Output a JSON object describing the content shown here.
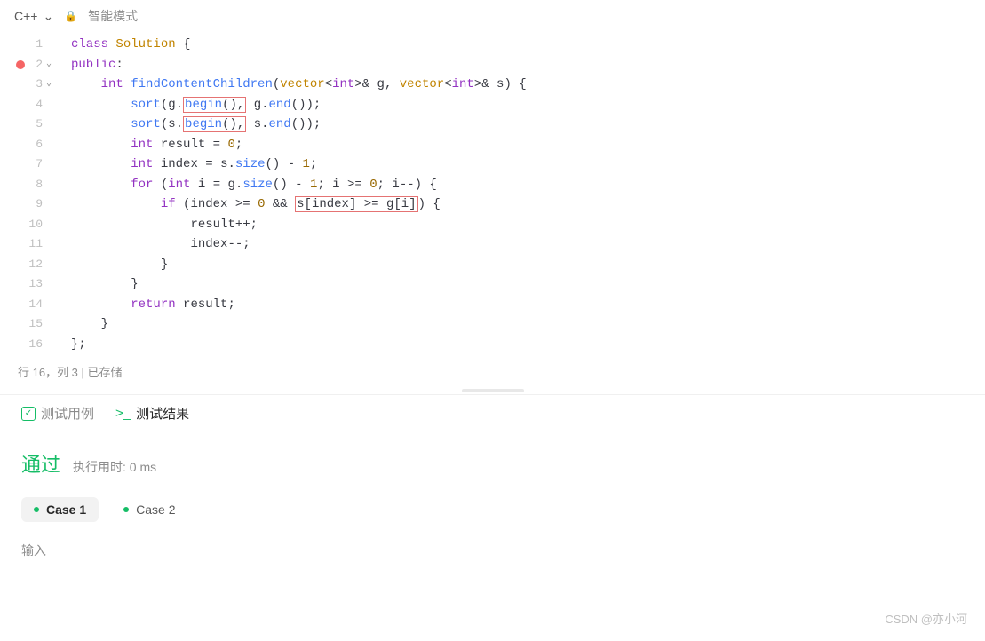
{
  "toolbar": {
    "language": "C++",
    "mode_label": "智能模式"
  },
  "code": {
    "lines": [
      {
        "n": 1,
        "tokens": [
          [
            "kw",
            "class"
          ],
          [
            "sp",
            " "
          ],
          [
            "cls",
            "Solution"
          ],
          [
            "sp",
            " "
          ],
          [
            "punct",
            "{"
          ]
        ]
      },
      {
        "n": 2,
        "breakpoint": true,
        "fold": true,
        "tokens": [
          [
            "kw",
            "public"
          ],
          [
            "punct",
            ":"
          ]
        ]
      },
      {
        "n": 3,
        "fold": true,
        "indent": 1,
        "tokens": [
          [
            "kw",
            "int"
          ],
          [
            "sp",
            " "
          ],
          [
            "fn",
            "findContentChildren"
          ],
          [
            "punct",
            "("
          ],
          [
            "type",
            "vector"
          ],
          [
            "punct",
            "<"
          ],
          [
            "kw",
            "int"
          ],
          [
            "punct",
            ">& "
          ],
          [
            "ident",
            "g"
          ],
          [
            "punct",
            ", "
          ],
          [
            "type",
            "vector"
          ],
          [
            "punct",
            "<"
          ],
          [
            "kw",
            "int"
          ],
          [
            "punct",
            ">& "
          ],
          [
            "ident",
            "s"
          ],
          [
            "punct",
            ") {"
          ]
        ]
      },
      {
        "n": 4,
        "indent": 2,
        "tokens": [
          [
            "fn",
            "sort"
          ],
          [
            "punct",
            "("
          ],
          [
            "ident",
            "g"
          ],
          [
            "punct",
            "."
          ],
          [
            "box_start",
            ""
          ],
          [
            "fn",
            "begin"
          ],
          [
            "punct",
            "(),"
          ],
          [
            "box_end",
            ""
          ],
          [
            "sp",
            " "
          ],
          [
            "ident",
            "g"
          ],
          [
            "punct",
            "."
          ],
          [
            "fn",
            "end"
          ],
          [
            "punct",
            "());"
          ]
        ]
      },
      {
        "n": 5,
        "indent": 2,
        "tokens": [
          [
            "fn",
            "sort"
          ],
          [
            "punct",
            "("
          ],
          [
            "ident",
            "s"
          ],
          [
            "punct",
            "."
          ],
          [
            "box_start",
            ""
          ],
          [
            "fn",
            "begin"
          ],
          [
            "punct",
            "(),"
          ],
          [
            "box_end",
            ""
          ],
          [
            "sp",
            " "
          ],
          [
            "ident",
            "s"
          ],
          [
            "punct",
            "."
          ],
          [
            "fn",
            "end"
          ],
          [
            "punct",
            "());"
          ]
        ]
      },
      {
        "n": 6,
        "indent": 2,
        "tokens": [
          [
            "kw",
            "int"
          ],
          [
            "sp",
            " "
          ],
          [
            "ident",
            "result"
          ],
          [
            "sp",
            " "
          ],
          [
            "punct",
            "= "
          ],
          [
            "num",
            "0"
          ],
          [
            "punct",
            ";"
          ]
        ]
      },
      {
        "n": 7,
        "indent": 2,
        "tokens": [
          [
            "kw",
            "int"
          ],
          [
            "sp",
            " "
          ],
          [
            "ident",
            "index"
          ],
          [
            "sp",
            " "
          ],
          [
            "punct",
            "= "
          ],
          [
            "ident",
            "s"
          ],
          [
            "punct",
            "."
          ],
          [
            "fn",
            "size"
          ],
          [
            "punct",
            "() - "
          ],
          [
            "num",
            "1"
          ],
          [
            "punct",
            ";"
          ]
        ]
      },
      {
        "n": 8,
        "indent": 2,
        "tokens": [
          [
            "kw",
            "for"
          ],
          [
            "sp",
            " "
          ],
          [
            "punct",
            "("
          ],
          [
            "kw",
            "int"
          ],
          [
            "sp",
            " "
          ],
          [
            "ident",
            "i"
          ],
          [
            "sp",
            " "
          ],
          [
            "punct",
            "= "
          ],
          [
            "ident",
            "g"
          ],
          [
            "punct",
            "."
          ],
          [
            "fn",
            "size"
          ],
          [
            "punct",
            "() - "
          ],
          [
            "num",
            "1"
          ],
          [
            "punct",
            "; "
          ],
          [
            "ident",
            "i"
          ],
          [
            "sp",
            " "
          ],
          [
            "punct",
            ">= "
          ],
          [
            "num",
            "0"
          ],
          [
            "punct",
            "; "
          ],
          [
            "ident",
            "i"
          ],
          [
            "punct",
            "--) {"
          ]
        ]
      },
      {
        "n": 9,
        "indent": 3,
        "tokens": [
          [
            "kw",
            "if"
          ],
          [
            "sp",
            " "
          ],
          [
            "punct",
            "("
          ],
          [
            "ident",
            "index"
          ],
          [
            "sp",
            " "
          ],
          [
            "punct",
            ">= "
          ],
          [
            "num",
            "0"
          ],
          [
            "sp",
            " "
          ],
          [
            "punct",
            "&& "
          ],
          [
            "box_start",
            ""
          ],
          [
            "ident",
            "s"
          ],
          [
            "punct",
            "["
          ],
          [
            "ident",
            "index"
          ],
          [
            "punct",
            "] "
          ],
          [
            "punct",
            ">= "
          ],
          [
            "ident",
            "g"
          ],
          [
            "punct",
            "["
          ],
          [
            "ident",
            "i"
          ],
          [
            "punct",
            "]"
          ],
          [
            "box_end",
            ""
          ],
          [
            "punct",
            ") {"
          ]
        ]
      },
      {
        "n": 10,
        "indent": 4,
        "tokens": [
          [
            "ident",
            "result"
          ],
          [
            "punct",
            "++;"
          ]
        ]
      },
      {
        "n": 11,
        "indent": 4,
        "tokens": [
          [
            "ident",
            "index"
          ],
          [
            "punct",
            "--;"
          ]
        ]
      },
      {
        "n": 12,
        "indent": 3,
        "tokens": [
          [
            "punct",
            "}"
          ]
        ]
      },
      {
        "n": 13,
        "indent": 2,
        "tokens": [
          [
            "punct",
            "}"
          ]
        ]
      },
      {
        "n": 14,
        "indent": 2,
        "tokens": [
          [
            "kw",
            "return"
          ],
          [
            "sp",
            " "
          ],
          [
            "ident",
            "result"
          ],
          [
            "punct",
            ";"
          ]
        ]
      },
      {
        "n": 15,
        "indent": 1,
        "tokens": [
          [
            "punct",
            "}"
          ]
        ]
      },
      {
        "n": 16,
        "tokens": [
          [
            "punct",
            "};"
          ]
        ]
      }
    ]
  },
  "status_bar": {
    "position": "行 16，列 3",
    "sep": " | ",
    "saved": "已存储"
  },
  "results": {
    "tabs": {
      "testcases": "测试用例",
      "results": "测试结果"
    },
    "status": "通过",
    "time_label": "执行用时: 0 ms",
    "cases": [
      "Case 1",
      "Case 2"
    ],
    "input_label": "输入"
  },
  "watermark": "CSDN @亦小河"
}
